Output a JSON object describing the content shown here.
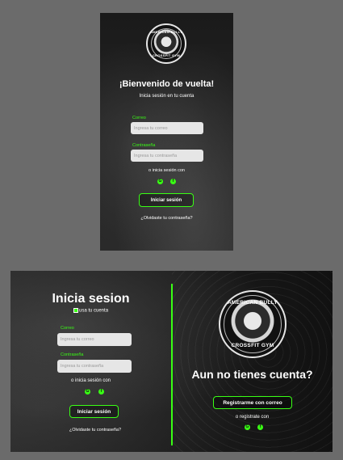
{
  "mobile": {
    "logo_top": "AMERICAN BULLY",
    "logo_bottom": "CROSSFIT GYM",
    "title": "¡Bienvenido de vuelta!",
    "subtitle": "Inicia sesión en tu cuenta",
    "email_label": "Correo",
    "email_placeholder": "Ingresa tu correo",
    "password_label": "Contraseña",
    "password_placeholder": "Ingresa tu contraseña",
    "social_text": "o inicia sesión con",
    "login_button": "Iniciar sesión",
    "forgot_link": "¿Olvidaste tu contraseña?"
  },
  "desktop": {
    "title": "Inicia sesion",
    "subtitle": "usa tu cuenta",
    "email_label": "Correo",
    "email_placeholder": "Ingresa tu correo",
    "password_label": "Contraseña",
    "password_placeholder": "Ingresa tu contraseña",
    "social_text": "o inicia sesión con",
    "login_button": "Iniciar sesión",
    "forgot_link": "¿Olvidaste tu contraseña?",
    "logo_top": "AMERICAN BULLY",
    "logo_bottom": "CROSSFIT GYM",
    "no_account_title": "Aun no tienes cuenta?",
    "register_button": "Registrarme con correo",
    "register_social_text": "o registrate con"
  },
  "icons": {
    "google": "G",
    "facebook": "f"
  },
  "colors": {
    "accent": "#39ff14",
    "field_bg": "#e6e6e6",
    "canvas": "#6b6b6b"
  }
}
